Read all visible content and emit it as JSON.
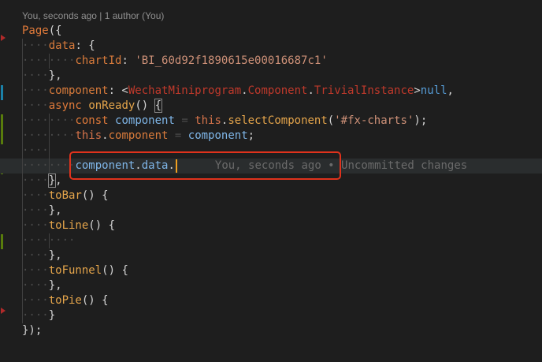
{
  "codelens": "You, seconds ago | 1 author (You)",
  "code": {
    "page": "Page",
    "data_key": "data",
    "chartId_key": "chartId",
    "chartId_value": "'BI_60d92f1890615e00016687c1'",
    "component_key": "component",
    "component_type_ns": "WechatMiniprogram",
    "component_type_mid": "Component",
    "component_type_name": "TrivialInstance",
    "null": "null",
    "async": "async",
    "onReady": "onReady",
    "const": "const",
    "component_var": "component",
    "this": "this",
    "selectComponent": "selectComponent",
    "selector": "'#fx-charts'",
    "this_component": "component",
    "assign_value": "component",
    "edit_var": "component",
    "edit_prop": "data",
    "toBar": "toBar",
    "toLine": "toLine",
    "toFunnel": "toFunnel",
    "toPie": "toPie"
  },
  "inline_blame": "You, seconds ago • Uncommitted changes",
  "colors": {
    "background": "#1e1e1e",
    "highlight_border": "#e0321c",
    "gutter_added": "#587c0c",
    "gutter_modified": "#1b81a8",
    "gutter_deleted": "#94151b"
  }
}
